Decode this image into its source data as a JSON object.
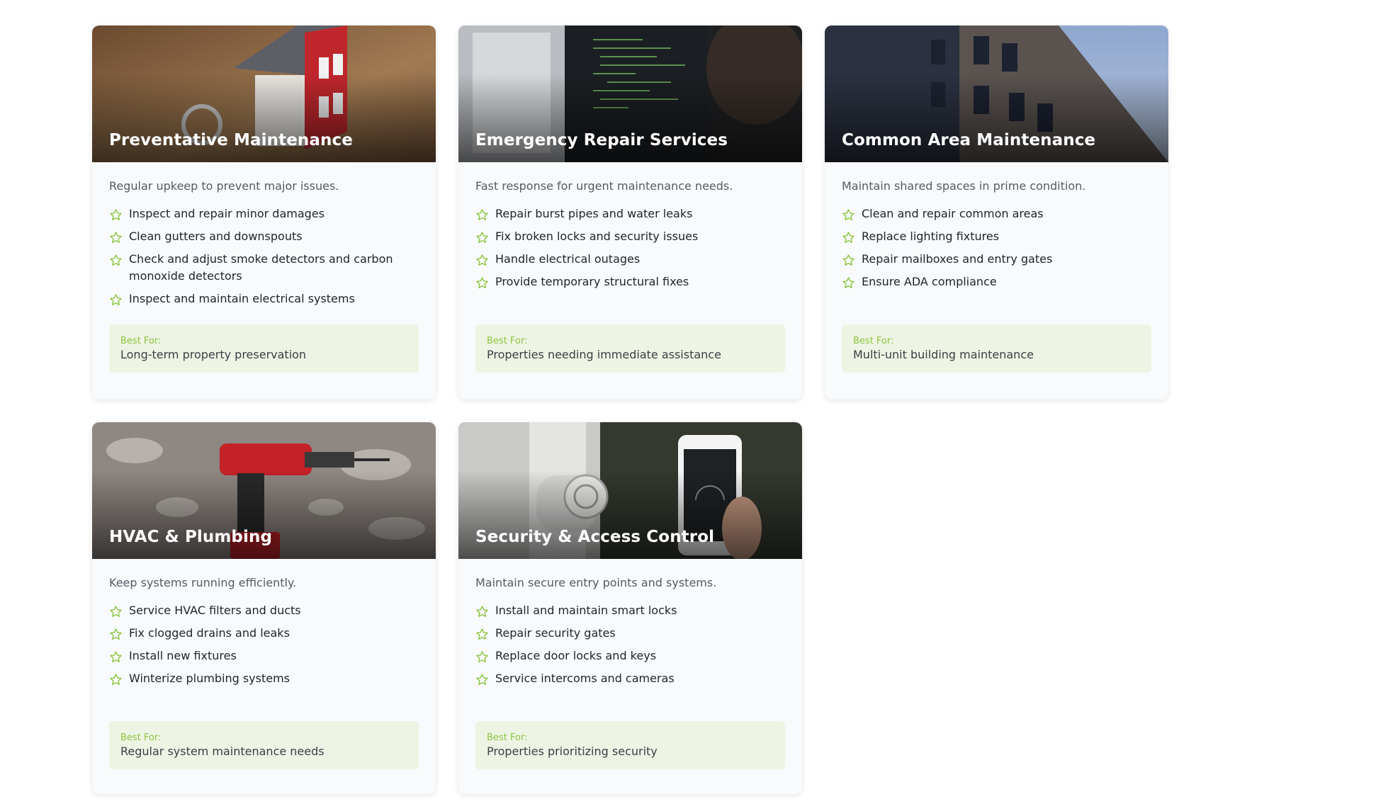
{
  "services": [
    {
      "title": "Preventative Maintenance",
      "description": "Regular upkeep to prevent major issues.",
      "features": [
        "Inspect and repair minor damages",
        "Clean gutters and downspouts",
        "Check and adjust smoke detectors and carbon monoxide detectors",
        "Inspect and maintain electrical systems"
      ],
      "best_for_label": "Best For:",
      "best_for": "Long-term property preservation"
    },
    {
      "title": "Emergency Repair Services",
      "description": "Fast response for urgent maintenance needs.",
      "features": [
        "Repair burst pipes and water leaks",
        "Fix broken locks and security issues",
        "Handle electrical outages",
        "Provide temporary structural fixes"
      ],
      "best_for_label": "Best For:",
      "best_for": "Properties needing immediate assistance"
    },
    {
      "title": "Common Area Maintenance",
      "description": "Maintain shared spaces in prime condition.",
      "features": [
        "Clean and repair common areas",
        "Replace lighting fixtures",
        "Repair mailboxes and entry gates",
        "Ensure ADA compliance"
      ],
      "best_for_label": "Best For:",
      "best_for": "Multi-unit building maintenance"
    },
    {
      "title": "HVAC & Plumbing",
      "description": "Keep systems running efficiently.",
      "features": [
        "Service HVAC filters and ducts",
        "Fix clogged drains and leaks",
        "Install new fixtures",
        "Winterize plumbing systems"
      ],
      "best_for_label": "Best For:",
      "best_for": "Regular system maintenance needs"
    },
    {
      "title": "Security & Access Control",
      "description": "Maintain secure entry points and systems.",
      "features": [
        "Install and maintain smart locks",
        "Repair security gates",
        "Replace door locks and keys",
        "Service intercoms and cameras"
      ],
      "best_for_label": "Best For:",
      "best_for": "Properties prioritizing security"
    }
  ],
  "icons": {
    "feature_bullet": "star-outline-icon"
  },
  "colors": {
    "accent_green": "#8cc63f",
    "best_for_background": "#eef4e4",
    "card_background": "#f8fafc"
  }
}
